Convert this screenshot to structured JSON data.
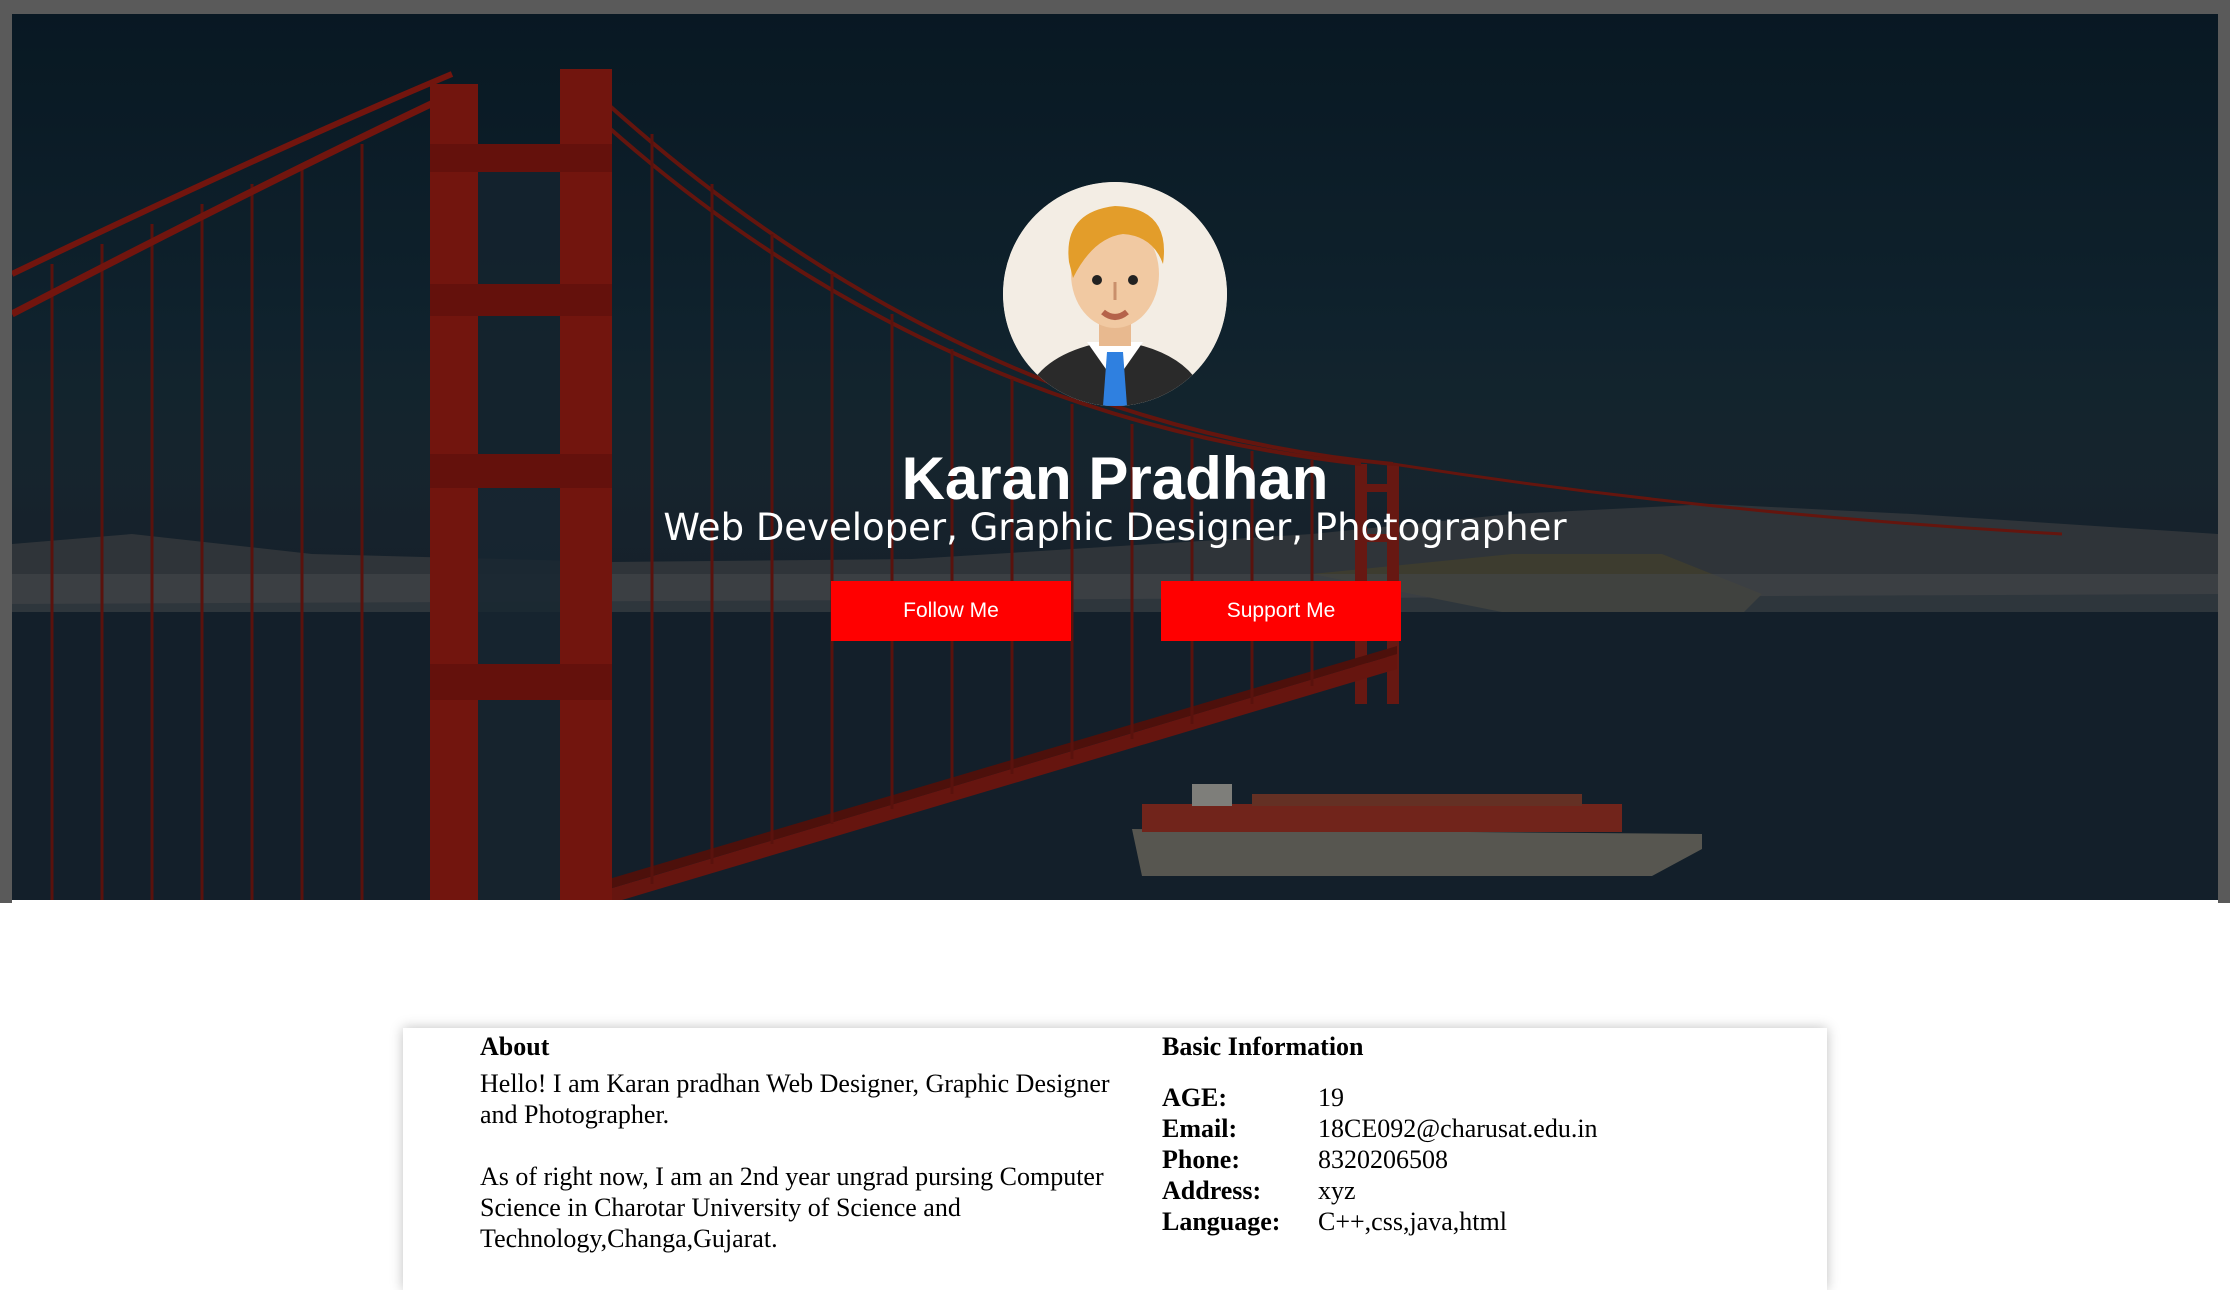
{
  "profile": {
    "name": "Karan Pradhan",
    "subtitle": "Web Developer, Graphic Designer, Photographer",
    "follow_label": "Follow Me",
    "support_label": "Support Me"
  },
  "about": {
    "title": "About",
    "paragraph1": "Hello! I am Karan pradhan Web Designer, Graphic Designer and Photographer.",
    "paragraph2": "As of right now, I am an 2nd year ungrad pursing Computer Science in Charotar University of Science and Technology,Changa,Gujarat."
  },
  "basic_info": {
    "title": "Basic Information",
    "rows": [
      {
        "label": "AGE:",
        "value": "19"
      },
      {
        "label": "Email:",
        "value": "18CE092@charusat.edu.in"
      },
      {
        "label": "Phone:",
        "value": "8320206508"
      },
      {
        "label": "Address:",
        "value": "xyz"
      },
      {
        "label": "Language:",
        "value": "C++,css,java,html"
      }
    ]
  },
  "colors": {
    "button": "#ff0000",
    "hero_overlay": "#13232f",
    "bridge": "#8b1a12"
  },
  "icons": {
    "avatar": "man-avatar-icon"
  }
}
